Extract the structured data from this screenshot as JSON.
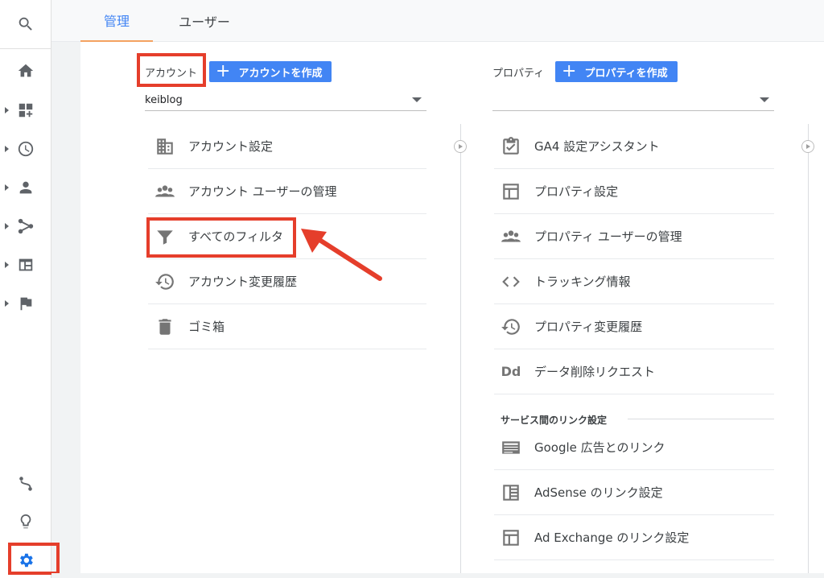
{
  "tabs": [
    {
      "label": "管理",
      "active": true
    },
    {
      "label": "ユーザー",
      "active": false
    }
  ],
  "rail": {
    "items": [
      "search-icon",
      "home-icon",
      "customization-icon",
      "realtime-icon",
      "audience-icon",
      "acquisition-icon",
      "behavior-icon",
      "conversions-icon",
      "attribution-icon",
      "discover-icon",
      "admin-gear-icon"
    ]
  },
  "account": {
    "label": "アカウント",
    "create_button": "アカウントを作成",
    "selected": "keiblog",
    "items": [
      {
        "label": "アカウント設定",
        "icon": "building-icon"
      },
      {
        "label": "アカウント ユーザーの管理",
        "icon": "people-icon"
      },
      {
        "label": "すべてのフィルタ",
        "icon": "filter-icon"
      },
      {
        "label": "アカウント変更履歴",
        "icon": "history-icon"
      },
      {
        "label": "ゴミ箱",
        "icon": "trash-icon"
      }
    ]
  },
  "property": {
    "label": "プロパティ",
    "create_button": "プロパティを作成",
    "selected": "",
    "items": [
      {
        "label": "GA4 設定アシスタント",
        "icon": "checklist-icon"
      },
      {
        "label": "プロパティ設定",
        "icon": "layout-icon"
      },
      {
        "label": "プロパティ ユーザーの管理",
        "icon": "people-icon"
      },
      {
        "label": "トラッキング情報",
        "icon": "code-icon"
      },
      {
        "label": "プロパティ変更履歴",
        "icon": "history-icon"
      },
      {
        "label": "データ削除リクエスト",
        "icon": "dd-icon",
        "icon_text": "Dd"
      }
    ],
    "links_section": "サービス間のリンク設定",
    "links": [
      {
        "label": "Google 広告とのリンク",
        "icon": "ads-icon"
      },
      {
        "label": "AdSense のリンク設定",
        "icon": "adsense-icon"
      },
      {
        "label": "Ad Exchange のリンク設定",
        "icon": "layout-icon"
      }
    ]
  },
  "colors": {
    "accent": "#4285f4",
    "highlight": "#e53e2b",
    "tab_underline": "#f4a261",
    "gear_active": "#1a73e8"
  }
}
